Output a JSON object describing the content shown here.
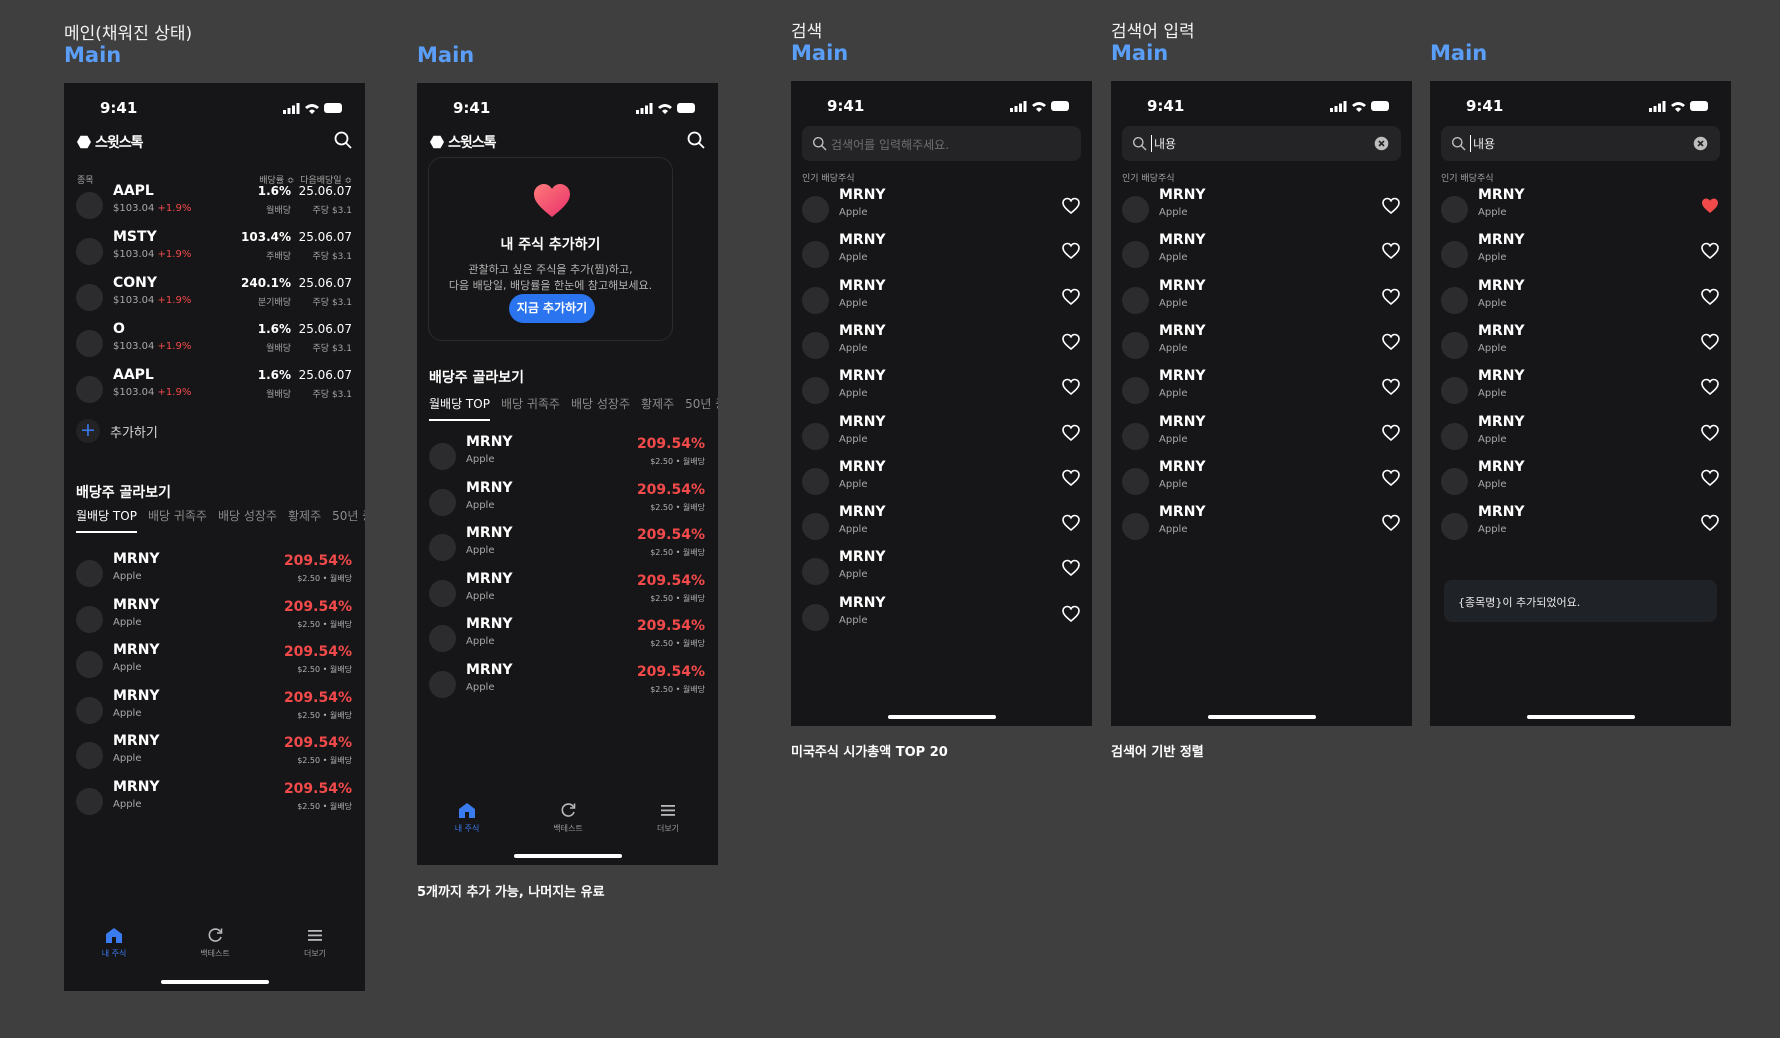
{
  "screens": [
    {
      "title": "메인(채워진 상태)",
      "label": "Main"
    },
    {
      "title": "",
      "label": "Main",
      "caption": "5개까지 추가 가능, 나머지는 유료"
    },
    {
      "title": "검색",
      "label": "Main",
      "caption": "미국주식 시가총액 TOP 20"
    },
    {
      "title": "검색어 입력",
      "label": "Main",
      "caption": "검색어 기반 정렬"
    },
    {
      "title": "",
      "label": "Main"
    }
  ],
  "status": {
    "time": "9:41"
  },
  "app": {
    "logo": "스윗스톡"
  },
  "watch_header": {
    "col_name": "종목",
    "col_yield": "배당률 ≎",
    "col_next": "다음배당일 ≎"
  },
  "watchlist": [
    {
      "ticker": "AAPL",
      "price": "$103.04",
      "change": "+1.9%",
      "yield": "1.6%",
      "freq": "월배당",
      "date": "25.06.07",
      "dps": "주당 $3.1"
    },
    {
      "ticker": "MSTY",
      "price": "$103.04",
      "change": "+1.9%",
      "yield": "103.4%",
      "freq": "주배당",
      "date": "25.06.07",
      "dps": "주당 $3.1"
    },
    {
      "ticker": "CONY",
      "price": "$103.04",
      "change": "+1.9%",
      "yield": "240.1%",
      "freq": "분기배당",
      "date": "25.06.07",
      "dps": "주당 $3.1"
    },
    {
      "ticker": "O",
      "price": "$103.04",
      "change": "+1.9%",
      "yield": "1.6%",
      "freq": "월배당",
      "date": "25.06.07",
      "dps": "주당 $3.1"
    },
    {
      "ticker": "AAPL",
      "price": "$103.04",
      "change": "+1.9%",
      "yield": "1.6%",
      "freq": "월배당",
      "date": "25.06.07",
      "dps": "주당 $3.1"
    }
  ],
  "add_label": "추가하기",
  "section_title": "배당주 골라보기",
  "tabs": [
    "월배당 TOP",
    "배당 귀족주",
    "배당 성장주",
    "황제주",
    "50년 증"
  ],
  "dividend_rows": [
    {
      "ticker": "MRNY",
      "name": "Apple",
      "pct": "209.54%",
      "meta": "$2.50 • 월배당"
    },
    {
      "ticker": "MRNY",
      "name": "Apple",
      "pct": "209.54%",
      "meta": "$2.50 • 월배당"
    },
    {
      "ticker": "MRNY",
      "name": "Apple",
      "pct": "209.54%",
      "meta": "$2.50 • 월배당"
    },
    {
      "ticker": "MRNY",
      "name": "Apple",
      "pct": "209.54%",
      "meta": "$2.50 • 월배당"
    },
    {
      "ticker": "MRNY",
      "name": "Apple",
      "pct": "209.54%",
      "meta": "$2.50 • 월배당"
    },
    {
      "ticker": "MRNY",
      "name": "Apple",
      "pct": "209.54%",
      "meta": "$2.50 • 월배당"
    }
  ],
  "nav": [
    {
      "label": "내 주식",
      "icon": "home-icon"
    },
    {
      "label": "백테스트",
      "icon": "refresh-icon"
    },
    {
      "label": "더보기",
      "icon": "menu-icon"
    }
  ],
  "empty_card": {
    "title": "내 주식 추가하기",
    "desc1": "관찰하고 싶은 주식을 추가(찜)하고,",
    "desc2": "다음 배당일, 배당률을 한눈에 참고해보세요.",
    "button": "지금 추가하기"
  },
  "search": {
    "placeholder": "검색어를 입력해주세요.",
    "query": "내용",
    "popular_label": "인기 배당주식"
  },
  "search_item": {
    "ticker": "MRNY",
    "name": "Apple"
  },
  "toast": "{종목명}이 추가되었어요.",
  "colors": {
    "accent": "#2a74f0",
    "up": "#f24a4a",
    "label": "#5b9ef8",
    "background": "#3f3f3f",
    "screen": "#161618"
  }
}
